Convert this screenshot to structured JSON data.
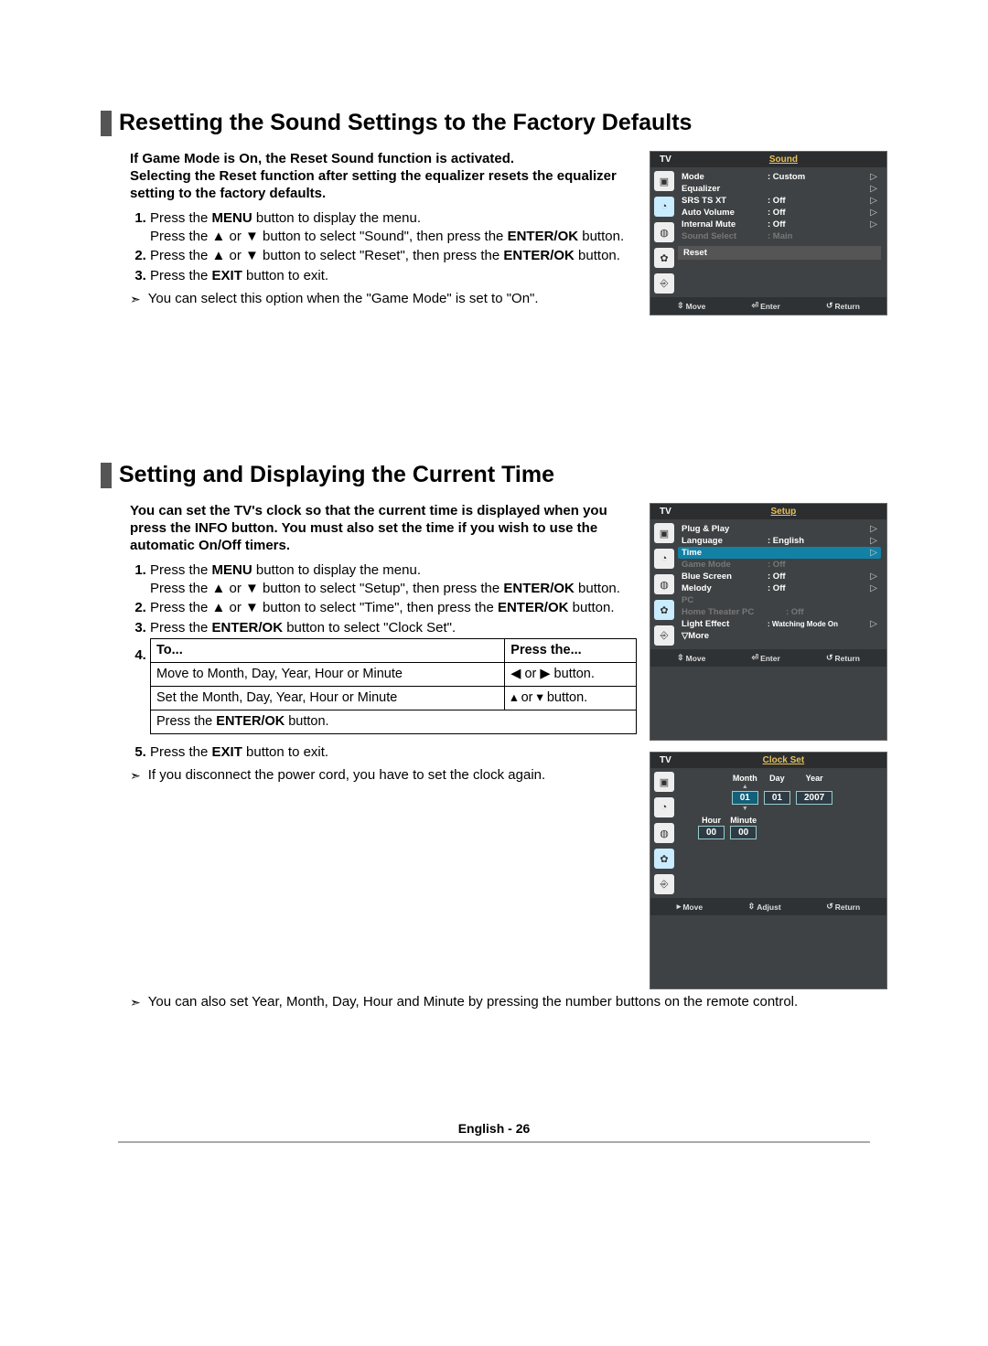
{
  "section1": {
    "title": "Resetting the Sound Settings to the Factory Defaults",
    "intro_line1": "If Game Mode is On, the Reset Sound function is activated.",
    "intro_line2": "Selecting the Reset function after setting the equalizer resets the equalizer setting to the factory defaults.",
    "step1_a": "Press the ",
    "step1_menu": "MENU",
    "step1_b": " button to display the menu.",
    "step1_c": "Press the ▲ or ▼ button to select \"Sound\", then press the ",
    "step1_enterok": "ENTER/OK",
    "step1_d": " button.",
    "step2_a": "Press the ▲ or ▼ button to select \"Reset\", then press the ",
    "step2_enterok": "ENTER/OK",
    "step2_b": " button.",
    "step3_a": "Press the ",
    "step3_exit": "EXIT",
    "step3_b": " button to exit.",
    "note1": "You can select this option when the \"Game Mode\" is set to \"On\".",
    "osd": {
      "tv": "TV",
      "title": "Sound",
      "rows": [
        {
          "label": "Mode",
          "val": ": Custom",
          "arrow": true
        },
        {
          "label": "Equalizer",
          "val": "",
          "arrow": true
        },
        {
          "label": "SRS TS XT",
          "val": ": Off",
          "arrow": true
        },
        {
          "label": "Auto Volume",
          "val": ": Off",
          "arrow": true
        },
        {
          "label": "Internal Mute",
          "val": ": Off",
          "arrow": true
        }
      ],
      "dim": {
        "label": "Sound Select",
        "val": ": Main"
      },
      "reset": "Reset",
      "footer_move": "Move",
      "footer_enter": "Enter",
      "footer_return": "Return"
    }
  },
  "section2": {
    "title": "Setting and Displaying the Current Time",
    "intro": "You can set the TV's clock so that the current time is displayed when you press the INFO button. You must also set the time if you wish to use the automatic On/Off timers.",
    "step1_a": "Press the ",
    "step1_menu": "MENU",
    "step1_b": " button to display the menu.",
    "step1_c": "Press the ▲ or ▼ button to select \"Setup\", then press the ",
    "step1_enterok": "ENTER/OK",
    "step1_d": " button.",
    "step2_a": "Press the ▲ or ▼ button to select \"Time\", then press the ",
    "step2_enterok": "ENTER/OK",
    "step2_b": " button.",
    "step3_a": "Press the ",
    "step3_enterok": "ENTER/OK",
    "step3_b": " button to select \"Clock Set\".",
    "table": {
      "head_to": "To...",
      "head_press": "Press the...",
      "r1_to": "Move to Month, Day, Year, Hour or Minute",
      "r1_press": "◀ or ▶ button.",
      "r2_to": "Set the Month, Day, Year, Hour or Minute",
      "r2_press": "▴ or ▾ button.",
      "r3_to_a": "Press the ",
      "r3_to_b": "ENTER/OK",
      "r3_to_c": " button."
    },
    "step5_a": "Press the ",
    "step5_exit": "EXIT",
    "step5_b": " button to exit.",
    "note1": "If you disconnect the power cord, you have to set the clock again.",
    "note2": "You can also set Year, Month, Day, Hour and Minute by pressing the number buttons on the remote control.",
    "osd_setup": {
      "tv": "TV",
      "title": "Setup",
      "rows": [
        {
          "label": "Plug & Play",
          "val": "",
          "arrow": true
        },
        {
          "label": "Language",
          "val": ": English",
          "arrow": true
        }
      ],
      "highlight": {
        "label": "Time",
        "arrow": true
      },
      "dim1": {
        "label": "Game Mode",
        "val": ": Off"
      },
      "rows2": [
        {
          "label": "Blue Screen",
          "val": ": Off",
          "arrow": true
        },
        {
          "label": "Melody",
          "val": ": Off",
          "arrow": true
        }
      ],
      "dim2": {
        "label": "PC",
        "val": ""
      },
      "dim3": {
        "label": "Home Theater PC",
        "val": ": Off"
      },
      "rows3": [
        {
          "label": "Light Effect",
          "val": ": Watching Mode On",
          "arrow": true
        }
      ],
      "more": "▽More",
      "footer_move": "Move",
      "footer_enter": "Enter",
      "footer_return": "Return"
    },
    "osd_clock": {
      "tv": "TV",
      "title": "Clock Set",
      "month_label": "Month",
      "day_label": "Day",
      "year_label": "Year",
      "hour_label": "Hour",
      "minute_label": "Minute",
      "month_val": "01",
      "day_val": "01",
      "year_val": "2007",
      "hour_val": "00",
      "minute_val": "00",
      "footer_move": "Move",
      "footer_adjust": "Adjust",
      "footer_return": "Return"
    }
  },
  "footer": "English - 26"
}
